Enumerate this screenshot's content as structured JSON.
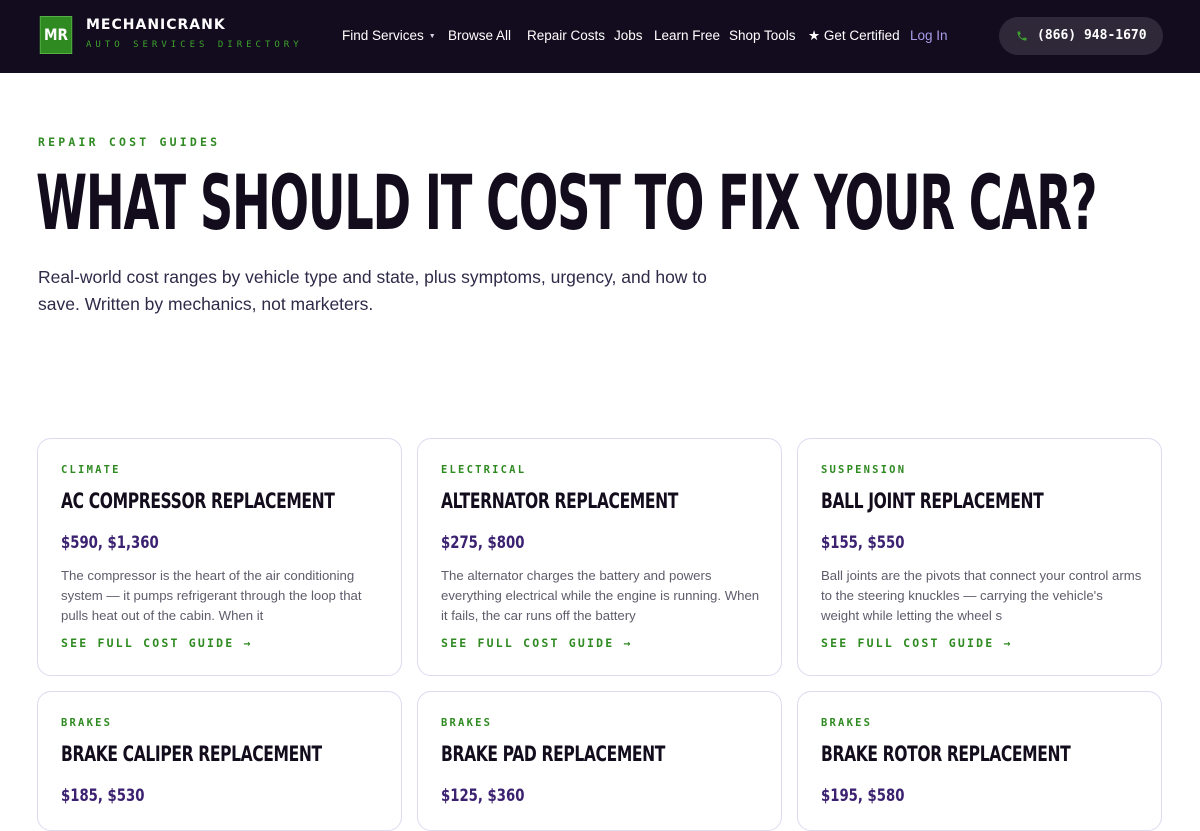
{
  "brand": {
    "logo_text": "MR",
    "name": "MECHANICRANK",
    "tagline": "AUTO SERVICES DIRECTORY"
  },
  "nav": {
    "items": [
      {
        "label": "Find Services",
        "has_dropdown": true
      },
      {
        "label": "Browse All"
      },
      {
        "label": "Repair Costs"
      },
      {
        "label": "Jobs"
      },
      {
        "label": "Learn Free"
      },
      {
        "label": "Shop Tools"
      },
      {
        "label": "★ Get Certified"
      }
    ],
    "login_label": "Log In",
    "phone": "(866) 948-1670",
    "phone_icon": "phone-icon",
    "dropdown_icon": "caret-down-icon"
  },
  "hero": {
    "eyebrow": "REPAIR COST GUIDES",
    "title": "WHAT SHOULD IT COST TO FIX YOUR CAR?",
    "subtitle": "Real-world cost ranges by vehicle type and state, plus symptoms, urgency, and how to save. Written by mechanics, not marketers."
  },
  "cards": [
    {
      "category": "CLIMATE",
      "title": "AC COMPRESSOR REPLACEMENT",
      "price": "$590, $1,360",
      "description": "The compressor is the heart of the air conditioning system — it pumps refrigerant through the loop that pulls heat out of the cabin. When it",
      "link": "SEE FULL COST GUIDE →"
    },
    {
      "category": "ELECTRICAL",
      "title": "ALTERNATOR REPLACEMENT",
      "price": "$275, $800",
      "description": "The alternator charges the battery and powers everything electrical while the engine is running. When it fails, the car runs off the battery",
      "link": "SEE FULL COST GUIDE →"
    },
    {
      "category": "SUSPENSION",
      "title": "BALL JOINT REPLACEMENT",
      "price": "$155, $550",
      "description": "Ball joints are the pivots that connect your control arms to the steering knuckles — carrying the vehicle's weight while letting the wheel s",
      "link": "SEE FULL COST GUIDE →"
    },
    {
      "category": "BRAKES",
      "title": "BRAKE CALIPER REPLACEMENT",
      "price": "$185, $530"
    },
    {
      "category": "BRAKES",
      "title": "BRAKE PAD REPLACEMENT",
      "price": "$125, $360"
    },
    {
      "category": "BRAKES",
      "title": "BRAKE ROTOR REPLACEMENT",
      "price": "$195, $580"
    }
  ],
  "colors": {
    "header_bg": "#130c1f",
    "accent_green": "#2f8a22",
    "price_purple": "#3b2170",
    "login_purple": "#a79ce8"
  }
}
